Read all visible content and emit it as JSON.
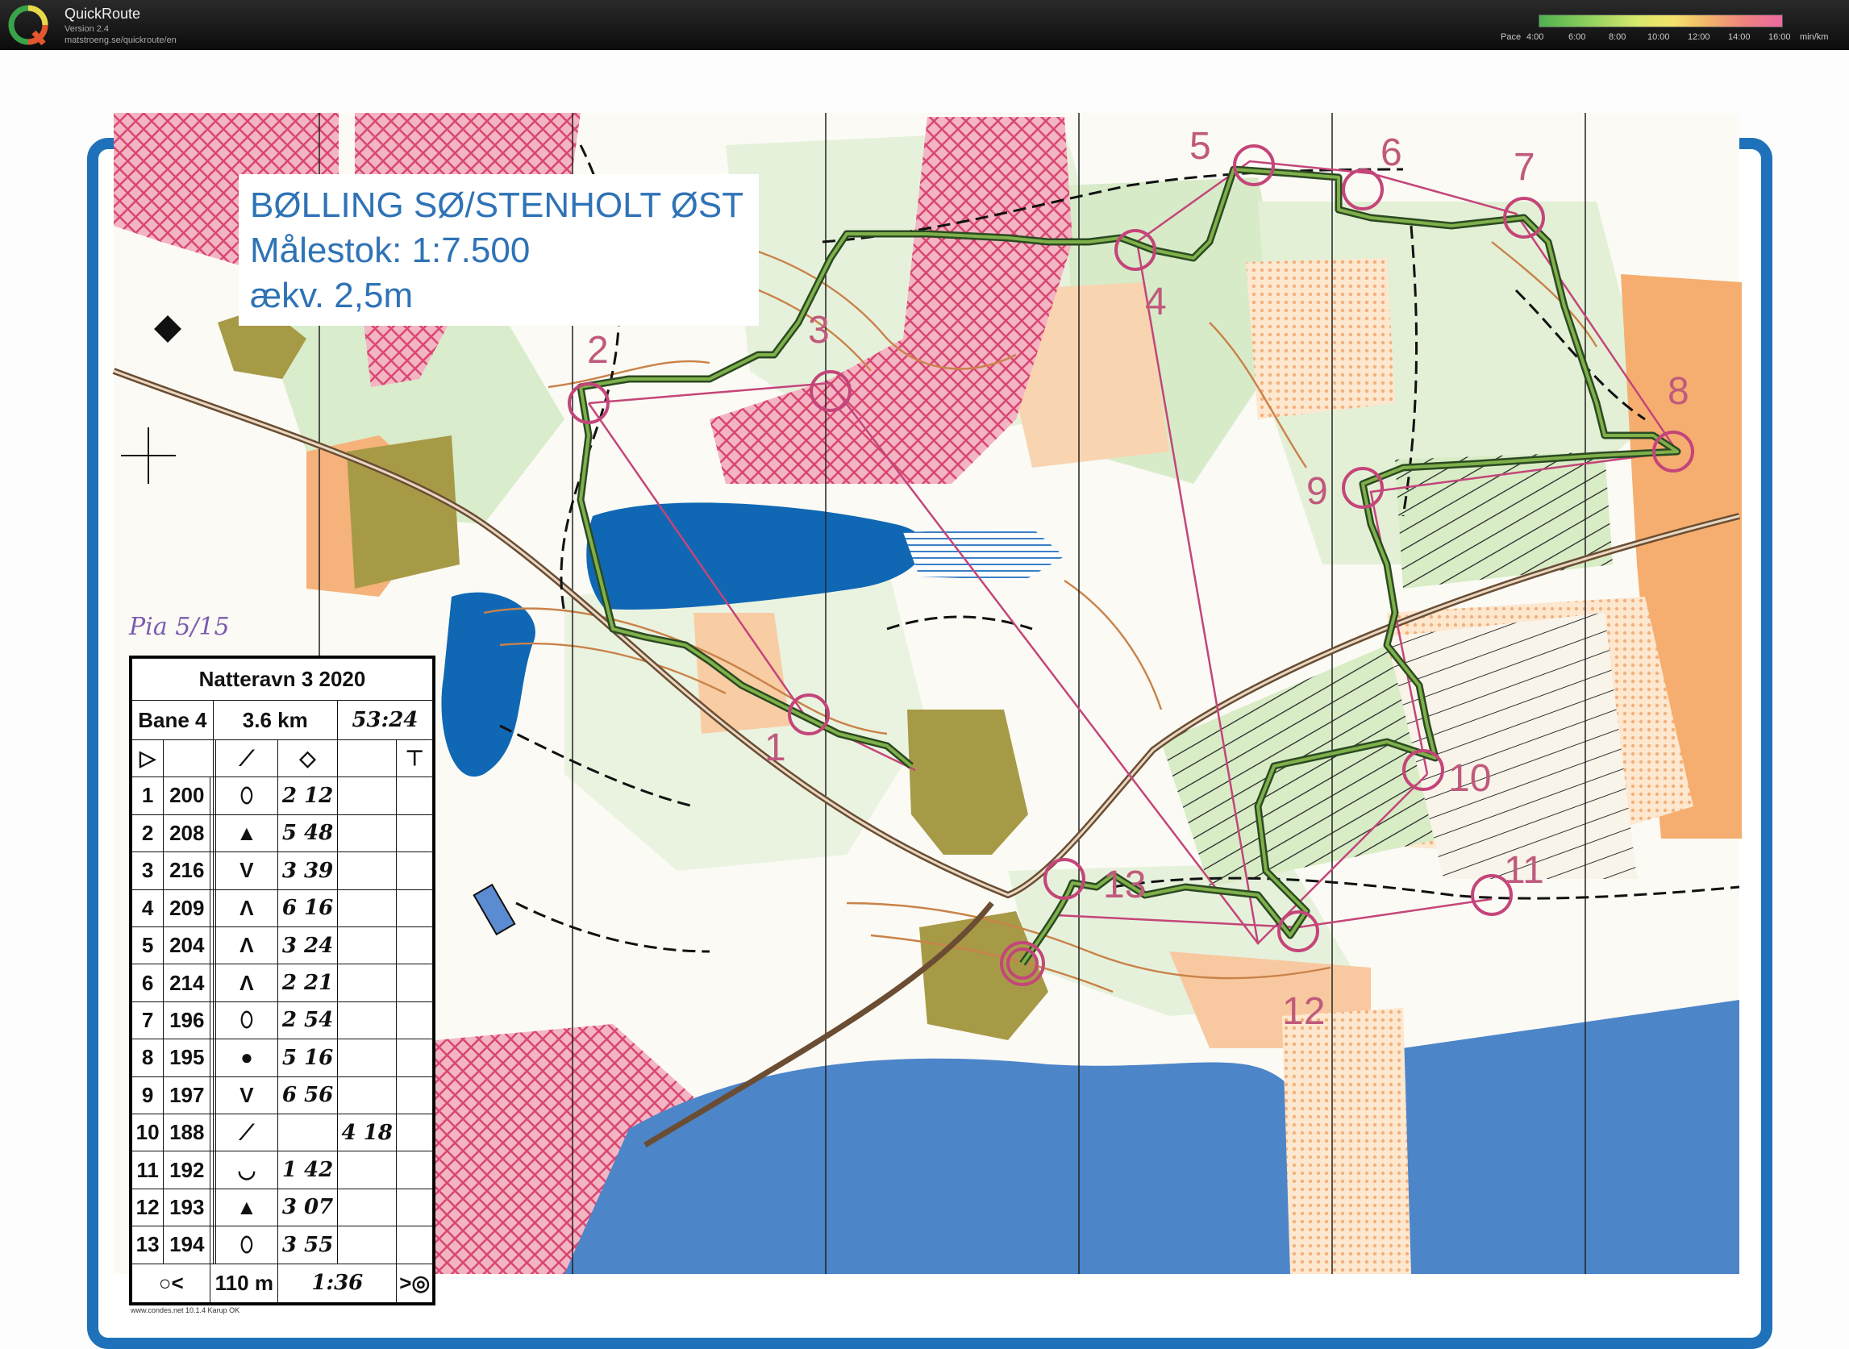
{
  "app": {
    "name": "QuickRoute",
    "version": "Version 2.4",
    "url": "matstroeng.se/quickroute/en"
  },
  "pace_scale": {
    "label": "Pace",
    "ticks": [
      "4:00",
      "6:00",
      "8:00",
      "10:00",
      "12:00",
      "14:00",
      "16:00"
    ],
    "unit": "min/km"
  },
  "map": {
    "title": "BØLLING SØ/STENHOLT ØST",
    "scale": "Målestok: 1:7.500",
    "contour": "ækv. 2,5m",
    "handwritten_note": "Pia 5/15",
    "credit": "www.condes.net 10.1.4 Karup OK",
    "credit2": "Natteravn 3 2020",
    "control_numbers": [
      "1",
      "2",
      "3",
      "4",
      "5",
      "6",
      "7",
      "8",
      "9",
      "10",
      "11",
      "12",
      "13"
    ]
  },
  "description_sheet": {
    "event": "Natteravn 3 2020",
    "course": "Bane 4",
    "length": "3.6 km",
    "total_time": "53:24",
    "rows": [
      {
        "n": "1",
        "code": "200",
        "feature": "⬯",
        "split": "2 12",
        "extra": ""
      },
      {
        "n": "2",
        "code": "208",
        "feature": "▲",
        "split": "5 48",
        "extra": ""
      },
      {
        "n": "3",
        "code": "216",
        "feature": "V",
        "split": "3 39",
        "extra": ""
      },
      {
        "n": "4",
        "code": "209",
        "feature": "Λ",
        "split": "6 16",
        "extra": ""
      },
      {
        "n": "5",
        "code": "204",
        "feature": "Λ",
        "split": "3 24",
        "extra": ""
      },
      {
        "n": "6",
        "code": "214",
        "feature": "Λ",
        "split": "2 21",
        "extra": ""
      },
      {
        "n": "7",
        "code": "196",
        "feature": "⬯",
        "split": "2 54",
        "extra": ""
      },
      {
        "n": "8",
        "code": "195",
        "feature": "●",
        "split": "5 16",
        "extra": ""
      },
      {
        "n": "9",
        "code": "197",
        "feature": "V",
        "split": "6 56",
        "extra": ""
      },
      {
        "n": "10",
        "code": "188",
        "feature": "⟋",
        "split": "",
        "extra": "4 18"
      },
      {
        "n": "11",
        "code": "192",
        "feature": "◡",
        "split": "1 42",
        "extra": ""
      },
      {
        "n": "12",
        "code": "193",
        "feature": "▲",
        "split": "3 07",
        "extra": ""
      },
      {
        "n": "13",
        "code": "194",
        "feature": "⬯",
        "split": "3 55",
        "extra": ""
      }
    ],
    "finish_distance": "110 m",
    "finish_split": "1:36"
  }
}
